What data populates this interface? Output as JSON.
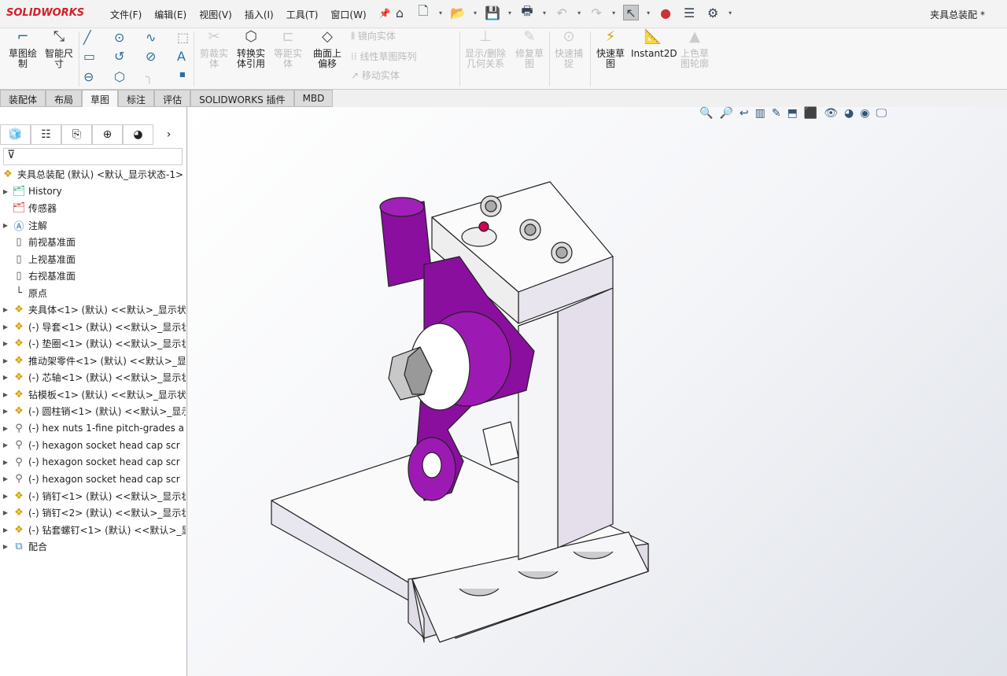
{
  "app": {
    "logo": "SOLIDWORKS",
    "document_title": "夹具总装配 *"
  },
  "menu": [
    "文件(F)",
    "编辑(E)",
    "视图(V)",
    "插入(I)",
    "工具(T)",
    "窗口(W)"
  ],
  "quick_access": [
    "home-icon",
    "new-icon",
    "open-icon",
    "save-icon",
    "print-icon",
    "undo-icon",
    "redo-icon",
    "select-icon",
    "traffic-light-icon",
    "options-list-icon",
    "gear-icon"
  ],
  "ribbon": {
    "sketch": "草图绘制",
    "smart_dim": "智能尺寸",
    "trim": "剪裁实体",
    "convert": "转换实体引用",
    "offset": "等距实体",
    "surface_offset": "曲面上偏移",
    "mirror": "镜向实体",
    "linear_pattern": "线性草图阵列",
    "move": "移动实体",
    "relations": "显示/删除几何关系",
    "repair": "修复草图",
    "quick_snap": "快速捕捉",
    "rapid_sketch": "快速草图",
    "instant2d": "Instant2D",
    "shaded": "上色草图轮廓"
  },
  "tabs": [
    {
      "label": "装配体"
    },
    {
      "label": "布局"
    },
    {
      "label": "草图",
      "active": true
    },
    {
      "label": "标注"
    },
    {
      "label": "评估"
    },
    {
      "label": "SOLIDWORKS 插件"
    },
    {
      "label": "MBD"
    }
  ],
  "tree": {
    "root": "夹具总装配 (默认) <默认_显示状态-1>",
    "items": [
      {
        "label": "History",
        "icon": "history-folder-icon",
        "exp": true
      },
      {
        "label": "传感器",
        "icon": "sensor-folder-icon",
        "exp": false
      },
      {
        "label": "注解",
        "icon": "annotation-icon",
        "exp": true
      },
      {
        "label": "前视基准面",
        "icon": "plane-icon",
        "exp": false
      },
      {
        "label": "上视基准面",
        "icon": "plane-icon",
        "exp": false
      },
      {
        "label": "右视基准面",
        "icon": "plane-icon",
        "exp": false
      },
      {
        "label": "原点",
        "icon": "origin-icon",
        "exp": false
      },
      {
        "label": "夹具体<1> (默认) <<默认>_显示状",
        "icon": "part-icon",
        "exp": true
      },
      {
        "label": "(-) 导套<1> (默认) <<默认>_显示状",
        "icon": "part-icon",
        "exp": true
      },
      {
        "label": "(-) 垫圈<1> (默认) <<默认>_显示状",
        "icon": "part-icon",
        "exp": true
      },
      {
        "label": "推动架零件<1> (默认) <<默认>_显",
        "icon": "part-icon",
        "exp": true
      },
      {
        "label": "(-) 芯轴<1> (默认) <<默认>_显示状",
        "icon": "part-icon",
        "exp": true
      },
      {
        "label": "钻模板<1> (默认) <<默认>_显示状",
        "icon": "part-icon",
        "exp": true
      },
      {
        "label": "(-) 圆柱销<1> (默认) <<默认>_显示",
        "icon": "part-icon",
        "exp": true
      },
      {
        "label": "(-) hex nuts 1-fine pitch-grades a",
        "icon": "toolbox-icon",
        "exp": true
      },
      {
        "label": "(-) hexagon socket head cap scr",
        "icon": "toolbox-icon",
        "exp": true
      },
      {
        "label": "(-) hexagon socket head cap scr",
        "icon": "toolbox-icon",
        "exp": true
      },
      {
        "label": "(-) hexagon socket head cap scr",
        "icon": "toolbox-icon",
        "exp": true
      },
      {
        "label": "(-) 销钉<1> (默认) <<默认>_显示状",
        "icon": "part-icon",
        "exp": true
      },
      {
        "label": "(-) 销钉<2> (默认) <<默认>_显示状",
        "icon": "part-icon",
        "exp": true
      },
      {
        "label": "(-) 钻套螺钉<1> (默认) <<默认>_显",
        "icon": "part-icon",
        "exp": true
      },
      {
        "label": "配合",
        "icon": "mates-icon",
        "exp": true
      }
    ]
  },
  "colors": {
    "accent": "#d0202a",
    "part_purple": "#8a0f9e",
    "part_grey": "#f2f2f4"
  }
}
